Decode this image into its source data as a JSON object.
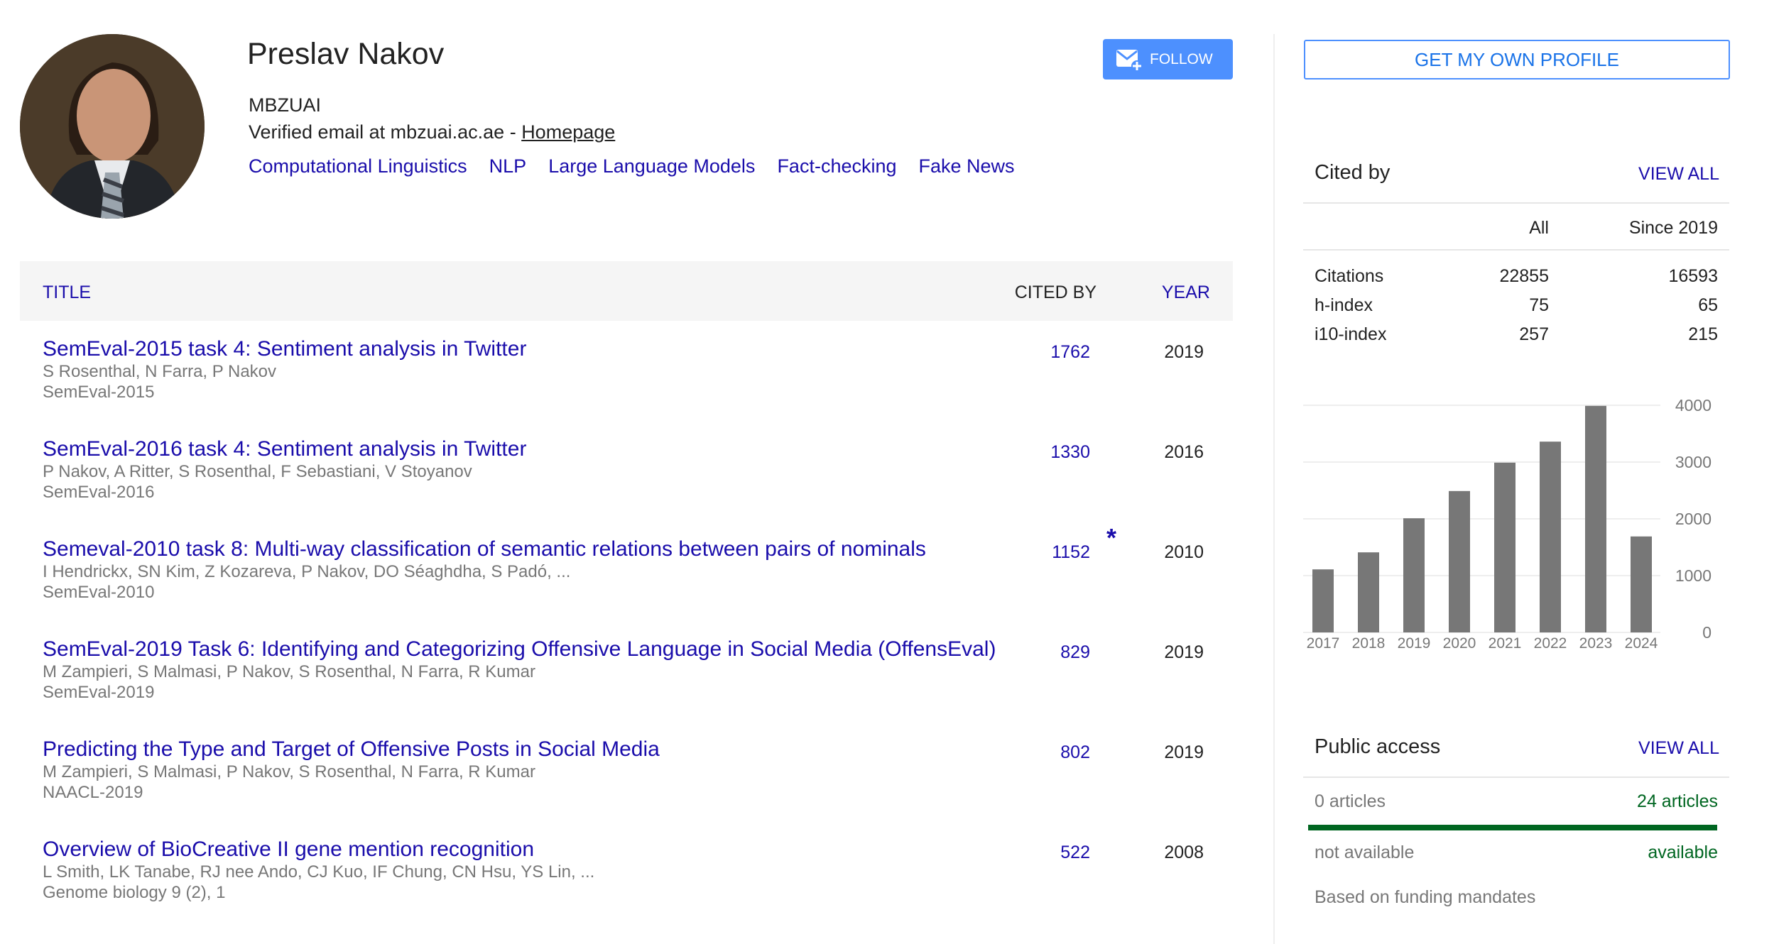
{
  "profile": {
    "name": "Preslav Nakov",
    "affiliation": "MBZUAI",
    "email_text": "Verified email at mbzuai.ac.ae - ",
    "homepage_label": "Homepage",
    "interests": [
      "Computational Linguistics",
      "NLP",
      "Large Language Models",
      "Fact-checking",
      "Fake News"
    ],
    "follow_label": "FOLLOW"
  },
  "table": {
    "headers": {
      "title": "TITLE",
      "cited_by": "CITED BY",
      "year": "YEAR"
    },
    "rows": [
      {
        "title": "SemEval-2015 task 4: Sentiment analysis in Twitter",
        "authors": "S Rosenthal, N Farra, P Nakov",
        "venue": "SemEval-2015",
        "cited_by": "1762",
        "star": "",
        "year": "2019"
      },
      {
        "title": "SemEval-2016 task 4: Sentiment analysis in Twitter",
        "authors": "P Nakov, A Ritter, S Rosenthal, F Sebastiani, V Stoyanov",
        "venue": "SemEval-2016",
        "cited_by": "1330",
        "star": "",
        "year": "2016"
      },
      {
        "title": "Semeval-2010 task 8: Multi-way classification of semantic relations between pairs of nominals",
        "authors": "I Hendrickx, SN Kim, Z Kozareva, P Nakov, DO Séaghdha, S Padó, ...",
        "venue": "SemEval-2010",
        "cited_by": "1152",
        "star": "*",
        "year": "2010"
      },
      {
        "title": "SemEval-2019 Task 6: Identifying and Categorizing Offensive Language in Social Media (OffensEval)",
        "authors": "M Zampieri, S Malmasi, P Nakov, S Rosenthal, N Farra, R Kumar",
        "venue": "SemEval-2019",
        "cited_by": "829",
        "star": "",
        "year": "2019"
      },
      {
        "title": "Predicting the Type and Target of Offensive Posts in Social Media",
        "authors": "M Zampieri, S Malmasi, P Nakov, S Rosenthal, N Farra, R Kumar",
        "venue": "NAACL-2019",
        "cited_by": "802",
        "star": "",
        "year": "2019"
      },
      {
        "title": "Overview of BioCreative II gene mention recognition",
        "authors": "L Smith, LK Tanabe, RJ nee Ando, CJ Kuo, IF Chung, CN Hsu, YS Lin, ...",
        "venue": "Genome biology 9 (2), 1",
        "cited_by": "522",
        "star": "",
        "year": "2008"
      }
    ]
  },
  "sidebar": {
    "own_profile_label": "GET MY OWN PROFILE",
    "cited_by": {
      "heading": "Cited by",
      "view_all": "VIEW ALL",
      "columns": [
        "",
        "All",
        "Since 2019"
      ],
      "rows": [
        [
          "Citations",
          "22855",
          "16593"
        ],
        [
          "h-index",
          "75",
          "65"
        ],
        [
          "i10-index",
          "257",
          "215"
        ]
      ]
    },
    "public_access": {
      "heading": "Public access",
      "view_all": "VIEW ALL",
      "left_count": "0 articles",
      "right_count": "24 articles",
      "left_label": "not available",
      "right_label": "available",
      "available_fraction": 1.0,
      "note": "Based on funding mandates"
    }
  },
  "colors": {
    "link": "#1a0dab",
    "follow_button": "#4d90fe",
    "bar": "#777777",
    "available_green": "#006621"
  },
  "chart_data": {
    "type": "bar",
    "title": "",
    "xlabel": "",
    "ylabel": "",
    "categories": [
      "2017",
      "2018",
      "2019",
      "2020",
      "2021",
      "2022",
      "2023",
      "2024"
    ],
    "values": [
      1110,
      1410,
      2010,
      2490,
      2990,
      3360,
      3990,
      1690
    ],
    "ylim": [
      0,
      4000
    ],
    "yticks": [
      0,
      1000,
      2000,
      3000,
      4000
    ],
    "grid": true,
    "y_axis_side": "right",
    "legend": "none"
  }
}
